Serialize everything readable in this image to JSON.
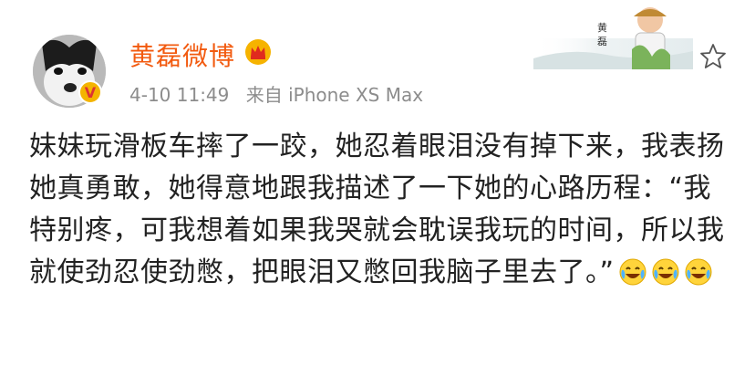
{
  "post": {
    "username": "黄磊微博",
    "date": "4-10 11:49",
    "source": "来自 iPhone XS Max",
    "text": "妹妹玩滑板车摔了一跤，她忍着眼泪没有掉下来，我表扬她真勇敢，她得意地跟我描述了一下她的心路历程：“我特别疼，可我想着如果我哭就会耽误我玩的时间，所以我就使劲忍使劲憋，把眼泪又憋回我脑子里去了。”",
    "emojis": [
      "laugh-cry-icon",
      "laugh-cry-icon",
      "laugh-cry-icon"
    ]
  },
  "banner": {
    "name_chars": "黄磊"
  },
  "colors": {
    "username": "#f25a0f",
    "meta": "#8c8c8c",
    "text": "#222222",
    "badge": "#f4b400"
  }
}
